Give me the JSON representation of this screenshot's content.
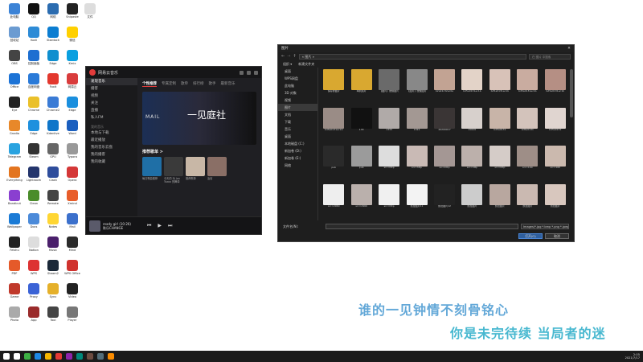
{
  "desktop": {
    "icons": [
      {
        "label": "此电脑",
        "color": "#3c83d6"
      },
      {
        "label": "QQ",
        "color": "#111"
      },
      {
        "label": "网络",
        "color": "#2b6cb0"
      },
      {
        "label": "Snipaste",
        "color": "#222"
      },
      {
        "label": "文件",
        "color": "#ddd"
      },
      {
        "label": "回收站",
        "color": "#6b9bd1"
      },
      {
        "label": "Kodi",
        "color": "#2d8bd6"
      },
      {
        "label": "Stardock",
        "color": "#0b7dd1"
      },
      {
        "label": "微信",
        "color": "#ffd000"
      },
      {
        "label": "OBS",
        "color": "#444"
      },
      {
        "label": "控制面板",
        "color": "#1d6fd1"
      },
      {
        "label": "Edge",
        "color": "#0f8fcf"
      },
      {
        "label": "Kmix",
        "color": "#0aa0e0"
      },
      {
        "label": "Office",
        "color": "#1c73d6"
      },
      {
        "label": "百度网盘",
        "color": "#2a7ad8"
      },
      {
        "label": "Foxit",
        "color": "#e3382e"
      },
      {
        "label": "网易云",
        "color": "#d93c3c"
      },
      {
        "label": "Eye",
        "color": "#222"
      },
      {
        "label": "Chrome",
        "color": "#eac02a"
      },
      {
        "label": "Chrome2",
        "color": "#3a7bd5"
      },
      {
        "label": "Edge",
        "color": "#1a8fde"
      },
      {
        "label": "Gradio",
        "color": "#e8882a"
      },
      {
        "label": "Edge",
        "color": "#1e90de"
      },
      {
        "label": "Kdenlive",
        "color": "#0f76c9"
      },
      {
        "label": "Word",
        "color": "#1b5fbf"
      },
      {
        "label": "Telegram",
        "color": "#2aa3e0"
      },
      {
        "label": "Steam",
        "color": "#333"
      },
      {
        "label": "GPU",
        "color": "#666"
      },
      {
        "label": "Typora",
        "color": "#999"
      },
      {
        "label": "Everything",
        "color": "#e37520"
      },
      {
        "label": "Lightroom",
        "color": "#24356c"
      },
      {
        "label": "Clash",
        "color": "#2e4d9c"
      },
      {
        "label": "Opera",
        "color": "#d43737"
      },
      {
        "label": "Bandicut",
        "color": "#8a3fd0"
      },
      {
        "label": "Clean",
        "color": "#4a8c2a"
      },
      {
        "label": "Remote",
        "color": "#444"
      },
      {
        "label": "Xmind",
        "color": "#e85d2a"
      },
      {
        "label": "Wallpaper",
        "color": "#1b7bd6"
      },
      {
        "label": "Docs",
        "color": "#4b8ad9"
      },
      {
        "label": "Notes",
        "color": "#ffd633"
      },
      {
        "label": "Mail",
        "color": "#3b70cc"
      },
      {
        "label": "Feishu",
        "color": "#222"
      },
      {
        "label": "Notion",
        "color": "#ddd"
      },
      {
        "label": "Music",
        "color": "#4a1f6b"
      },
      {
        "label": "Mind",
        "color": "#2b2b2b"
      },
      {
        "label": "PDF",
        "color": "#e55a2a"
      },
      {
        "label": "WPS",
        "color": "#d33"
      },
      {
        "label": "Steam2",
        "color": "#1b2838"
      },
      {
        "label": "WPS Office",
        "color": "#d0332f"
      },
      {
        "label": "Game",
        "color": "#c0392b"
      },
      {
        "label": "Proxy",
        "color": "#3b63d6"
      },
      {
        "label": "Sync",
        "color": "#e5b02a"
      },
      {
        "label": "Video",
        "color": "#222"
      },
      {
        "label": "Photo",
        "color": "#aaa"
      },
      {
        "label": "App",
        "color": "#9a2b2b"
      },
      {
        "label": "Tool",
        "color": "#444"
      },
      {
        "label": "Player",
        "color": "#777"
      }
    ]
  },
  "music": {
    "app_title": "网易云音乐",
    "sidebar": [
      {
        "label": "发现音乐",
        "active": true
      },
      {
        "label": "播客"
      },
      {
        "label": "视频"
      },
      {
        "label": "关注"
      },
      {
        "label": "直播"
      },
      {
        "label": "私人FM"
      }
    ],
    "sidebar_section": "我的音乐",
    "sidebar_my": [
      {
        "label": "本地与下载"
      },
      {
        "label": "最近播放"
      },
      {
        "label": "我的音乐云盘"
      },
      {
        "label": "我的播客"
      },
      {
        "label": "我的收藏"
      }
    ],
    "tabs": [
      {
        "label": "个性推荐",
        "active": true
      },
      {
        "label": "专属定制"
      },
      {
        "label": "歌单"
      },
      {
        "label": "排行榜"
      },
      {
        "label": "歌手"
      },
      {
        "label": "最新音乐"
      }
    ],
    "banner_text": "一见庭社",
    "banner_side": "MAIL",
    "rec_title": "推荐歌单 >",
    "covers": [
      {
        "color": "#1f6fa6",
        "caption": "每日歌曲推荐"
      },
      {
        "color": "#3a3a3a",
        "caption": "今天的 Dj Jon Tsaoo 的舞单 jackson"
      },
      {
        "color": "#c8b7a6",
        "caption": "推荐歌单"
      },
      {
        "color": "#8a6f66",
        "caption": "治愈"
      }
    ],
    "player": {
      "song": "ready girl (10:26)",
      "artist": "陈乐CHANGE"
    }
  },
  "dialog": {
    "title": "图片",
    "path": "« 图片 »",
    "search_placeholder": "在 图片 中搜索",
    "toolbar": [
      "组织 ▾",
      "新建文件夹"
    ],
    "nav": [
      {
        "label": "桌面"
      },
      {
        "label": "WPS网盘"
      },
      {
        "label": "此电脑"
      },
      {
        "label": "3D 对象"
      },
      {
        "label": "视频"
      },
      {
        "label": "图片",
        "selected": true
      },
      {
        "label": "文档"
      },
      {
        "label": "下载"
      },
      {
        "label": "音乐"
      },
      {
        "label": "桌面"
      },
      {
        "label": "本地磁盘 (C:)"
      },
      {
        "label": "新加卷 (D:)"
      },
      {
        "label": "新加卷 (E:)"
      },
      {
        "label": "网络"
      }
    ],
    "files": [
      {
        "name": "保存的图片",
        "color": "#d9a830"
      },
      {
        "name": "本机照片",
        "color": "#d9a830"
      },
      {
        "name": "【图片】微信图片",
        "color": "#6a6a6a"
      },
      {
        "name": "【图片】微信图片",
        "color": "#888"
      },
      {
        "name": "b2a22c32ac0a",
        "color": "#c2a393"
      },
      {
        "name": "bd5a0131ec1b",
        "color": "#e3d3c8"
      },
      {
        "name": "bd5a0131ec1b",
        "color": "#d8c2b8"
      },
      {
        "name": "bd5a0131ec1b",
        "color": "#c9aca0"
      },
      {
        "name": "bd5a0131ec1b",
        "color": "#b58f84"
      },
      {
        "name": "bd5a0131ec1b",
        "color": "#9a8c86"
      },
      {
        "name": "133",
        "color": "#111"
      },
      {
        "name": "1333",
        "color": "#b0aaa8"
      },
      {
        "name": "1322",
        "color": "#a39893"
      },
      {
        "name": "20200017",
        "color": "#3a3535"
      },
      {
        "name": "20210",
        "color": "#d7d0cc"
      },
      {
        "name": "bd5a0131",
        "color": "#c8b4a8"
      },
      {
        "name": "bd5a0131",
        "color": "#d3c3bb"
      },
      {
        "name": "bd5a0131",
        "color": "#e0d5d0"
      },
      {
        "name": "pub",
        "color": "#2a2a2a"
      },
      {
        "name": "pub",
        "color": "#9b9b9b"
      },
      {
        "name": "src=http",
        "color": "#ddd"
      },
      {
        "name": "src=http",
        "color": "#c9bab5"
      },
      {
        "name": "src=http",
        "color": "#a49794"
      },
      {
        "name": "src=http",
        "color": "#bcb0ab"
      },
      {
        "name": "src=http",
        "color": "#d5ccc8"
      },
      {
        "name": "src=160",
        "color": "#9e8e87"
      },
      {
        "name": "src=160",
        "color": "#cbb9ae"
      },
      {
        "name": "src=2960",
        "color": "#eee"
      },
      {
        "name": "src=2960",
        "color": "#bab0ac"
      },
      {
        "name": "src=http",
        "color": "#f0f0f0"
      },
      {
        "name": "凯拉图片11",
        "color": "#f3f3f3"
      },
      {
        "name": "凯拉图片12",
        "color": "#222"
      },
      {
        "name": "凯拉图片",
        "color": "#ccc"
      },
      {
        "name": "凯拉图片",
        "color": "#b8a79f"
      },
      {
        "name": "凯拉图片",
        "color": "#cab9b1"
      },
      {
        "name": "凯拉图片",
        "color": "#d8c7be"
      }
    ],
    "filename_label": "文件名(N):",
    "filetype": "Images(*.jpg *.bmp *.png *.jpeg)",
    "open_label": "打开(O)",
    "cancel_label": "取消"
  },
  "lyrics": {
    "line1": "谁的一见钟情不刻骨铭心",
    "line2": "你是未完待续 当局者的迷"
  },
  "taskbar": {
    "apps": [
      "#ffffff",
      "#3cb043",
      "#1e88e5",
      "#f4b400",
      "#e53935",
      "#8e24aa",
      "#00897b",
      "#6d4c41",
      "#546e7a",
      "#fb8c00"
    ],
    "time": "2:05",
    "date": "2021/7/17"
  }
}
